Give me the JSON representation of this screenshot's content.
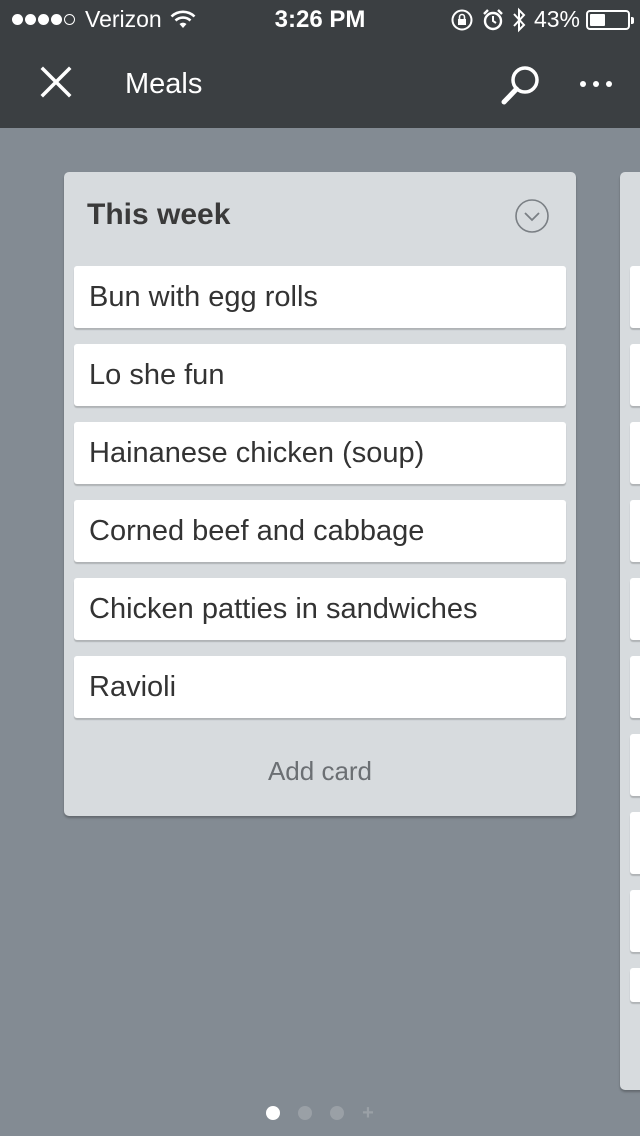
{
  "status_bar": {
    "carrier": "Verizon",
    "signal_bars": 4,
    "signal_total": 5,
    "time": "3:26 PM",
    "battery_percent": "43%",
    "battery_level": 0.43,
    "icons": [
      "wifi-icon",
      "orientation-lock-icon",
      "alarm-icon",
      "bluetooth-icon",
      "battery-icon"
    ]
  },
  "nav": {
    "title": "Meals",
    "icons": [
      "close-icon",
      "search-icon",
      "more-icon"
    ]
  },
  "list": {
    "title": "This week",
    "menu_icon": "chevron-down-circle-icon",
    "cards": [
      {
        "label": "Bun with egg rolls"
      },
      {
        "label": "Lo she fun"
      },
      {
        "label": "Hainanese chicken (soup)"
      },
      {
        "label": "Corned beef and cabbage"
      },
      {
        "label": "Chicken patties in sandwiches"
      },
      {
        "label": "Ravioli"
      }
    ],
    "add_card_label": "Add card"
  },
  "pager": {
    "pages": 3,
    "active_index": 0,
    "add_icon": "plus-icon"
  },
  "colors": {
    "nav_background": "#3b3f42",
    "board_background": "#838b93",
    "list_background": "#d7dbde",
    "card_background": "#ffffff"
  }
}
